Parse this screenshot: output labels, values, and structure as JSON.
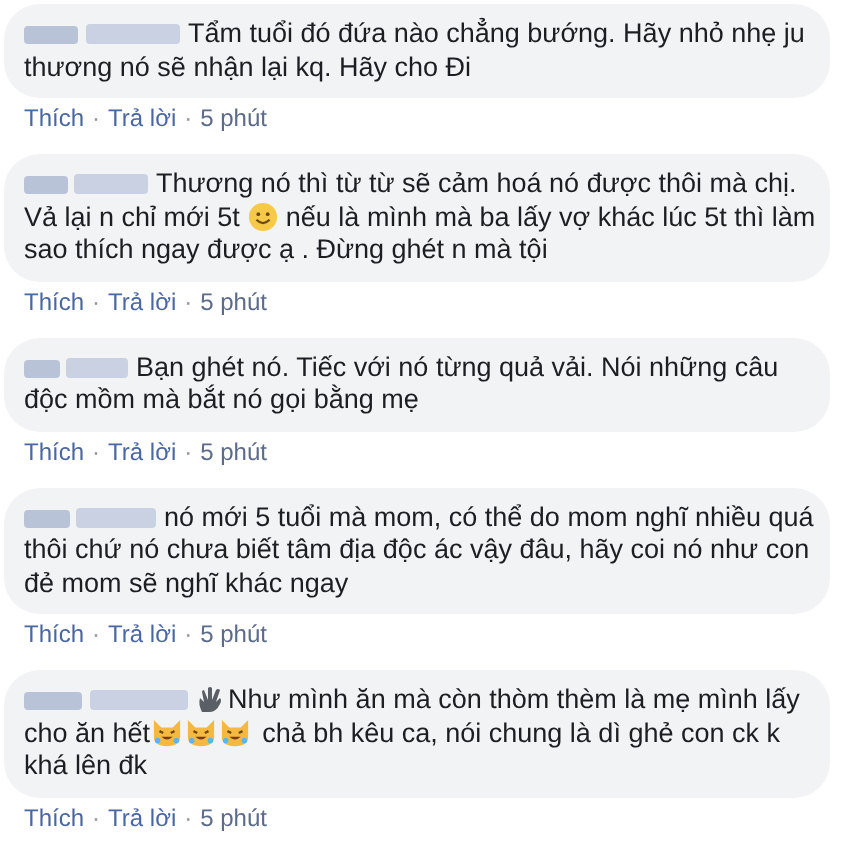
{
  "comments": [
    {
      "lines": [
        [
          {
            "kind": "text",
            "text": "Tẩm tuổi đó đứa nào chẳng bướng. Hãy nhỏ nhẹ ju"
          }
        ],
        [
          {
            "kind": "text",
            "text": "thương nó sẽ nhận lại kq. Hãy cho Đi"
          }
        ]
      ],
      "actions": [
        {
          "kind": "link",
          "text": "Thích"
        },
        {
          "kind": "sep",
          "text": "·"
        },
        {
          "kind": "link",
          "text": "Trả lời"
        },
        {
          "kind": "sep",
          "text": "·"
        },
        {
          "kind": "time",
          "text": "5 phút"
        }
      ]
    },
    {
      "lines": [
        [
          {
            "kind": "text",
            "text": "Thương nó thì từ từ sẽ cảm hoá nó được thôi mà chị."
          }
        ],
        [
          {
            "kind": "text",
            "text": "Vả lại n chỉ mới 5t"
          },
          {
            "kind": "smiley"
          },
          {
            "kind": "text",
            "text": "nếu là mình mà ba lấy vợ khác lúc 5t thì làm"
          }
        ],
        [
          {
            "kind": "text",
            "text": "sao thích ngay được ạ . Đừng ghét n mà tội"
          }
        ]
      ],
      "actions": [
        {
          "kind": "link",
          "text": "Thích"
        },
        {
          "kind": "sep",
          "text": "·"
        },
        {
          "kind": "link",
          "text": "Trả lời"
        },
        {
          "kind": "sep",
          "text": "·"
        },
        {
          "kind": "time",
          "text": "5 phút"
        }
      ]
    },
    {
      "lines": [
        [
          {
            "kind": "text",
            "text": "Bạn ghét nó. Tiếc với nó từng quả vải. Nói những câu"
          }
        ],
        [
          {
            "kind": "text",
            "text": "độc mồm mà bắt nó gọi bằng mẹ"
          }
        ]
      ],
      "actions": [
        {
          "kind": "link",
          "text": "Thích"
        },
        {
          "kind": "sep",
          "text": "·"
        },
        {
          "kind": "link",
          "text": "Trả lời"
        },
        {
          "kind": "sep",
          "text": "·"
        },
        {
          "kind": "time",
          "text": "5 phút"
        }
      ]
    },
    {
      "lines": [
        [
          {
            "kind": "text",
            "text": "nó mới 5 tuổi mà mom, có thể do mom nghĩ nhiều quá"
          }
        ],
        [
          {
            "kind": "text",
            "text": "thôi chứ nó chưa biết tâm địa độc ác vậy đâu, hãy coi nó như con"
          }
        ],
        [
          {
            "kind": "text",
            "text": "đẻ mom sẽ nghĩ khác ngay"
          }
        ]
      ],
      "actions": [
        {
          "kind": "link",
          "text": "Thích"
        },
        {
          "kind": "sep",
          "text": "·"
        },
        {
          "kind": "link",
          "text": "Trả lời"
        },
        {
          "kind": "sep",
          "text": "·"
        },
        {
          "kind": "time",
          "text": "5 phút"
        }
      ]
    },
    {
      "lines": [
        [
          {
            "kind": "hand"
          },
          {
            "kind": "text",
            "text": "Như mình ăn mà còn thòm thèm là mẹ mình lấy"
          }
        ],
        [
          {
            "kind": "text",
            "text": "cho ăn hết"
          },
          {
            "kind": "cat"
          },
          {
            "kind": "cat"
          },
          {
            "kind": "cat"
          },
          {
            "kind": "text",
            "text": "chả bh kêu ca, nói chung là dì ghẻ con ck k"
          }
        ],
        [
          {
            "kind": "text",
            "text": "khá lên đk"
          }
        ]
      ],
      "actions": [
        {
          "kind": "link",
          "text": "Thích"
        },
        {
          "kind": "sep",
          "text": "·"
        },
        {
          "kind": "link",
          "text": "Trả lời"
        },
        {
          "kind": "sep",
          "text": "·"
        },
        {
          "kind": "time",
          "text": "5 phút"
        }
      ]
    }
  ]
}
